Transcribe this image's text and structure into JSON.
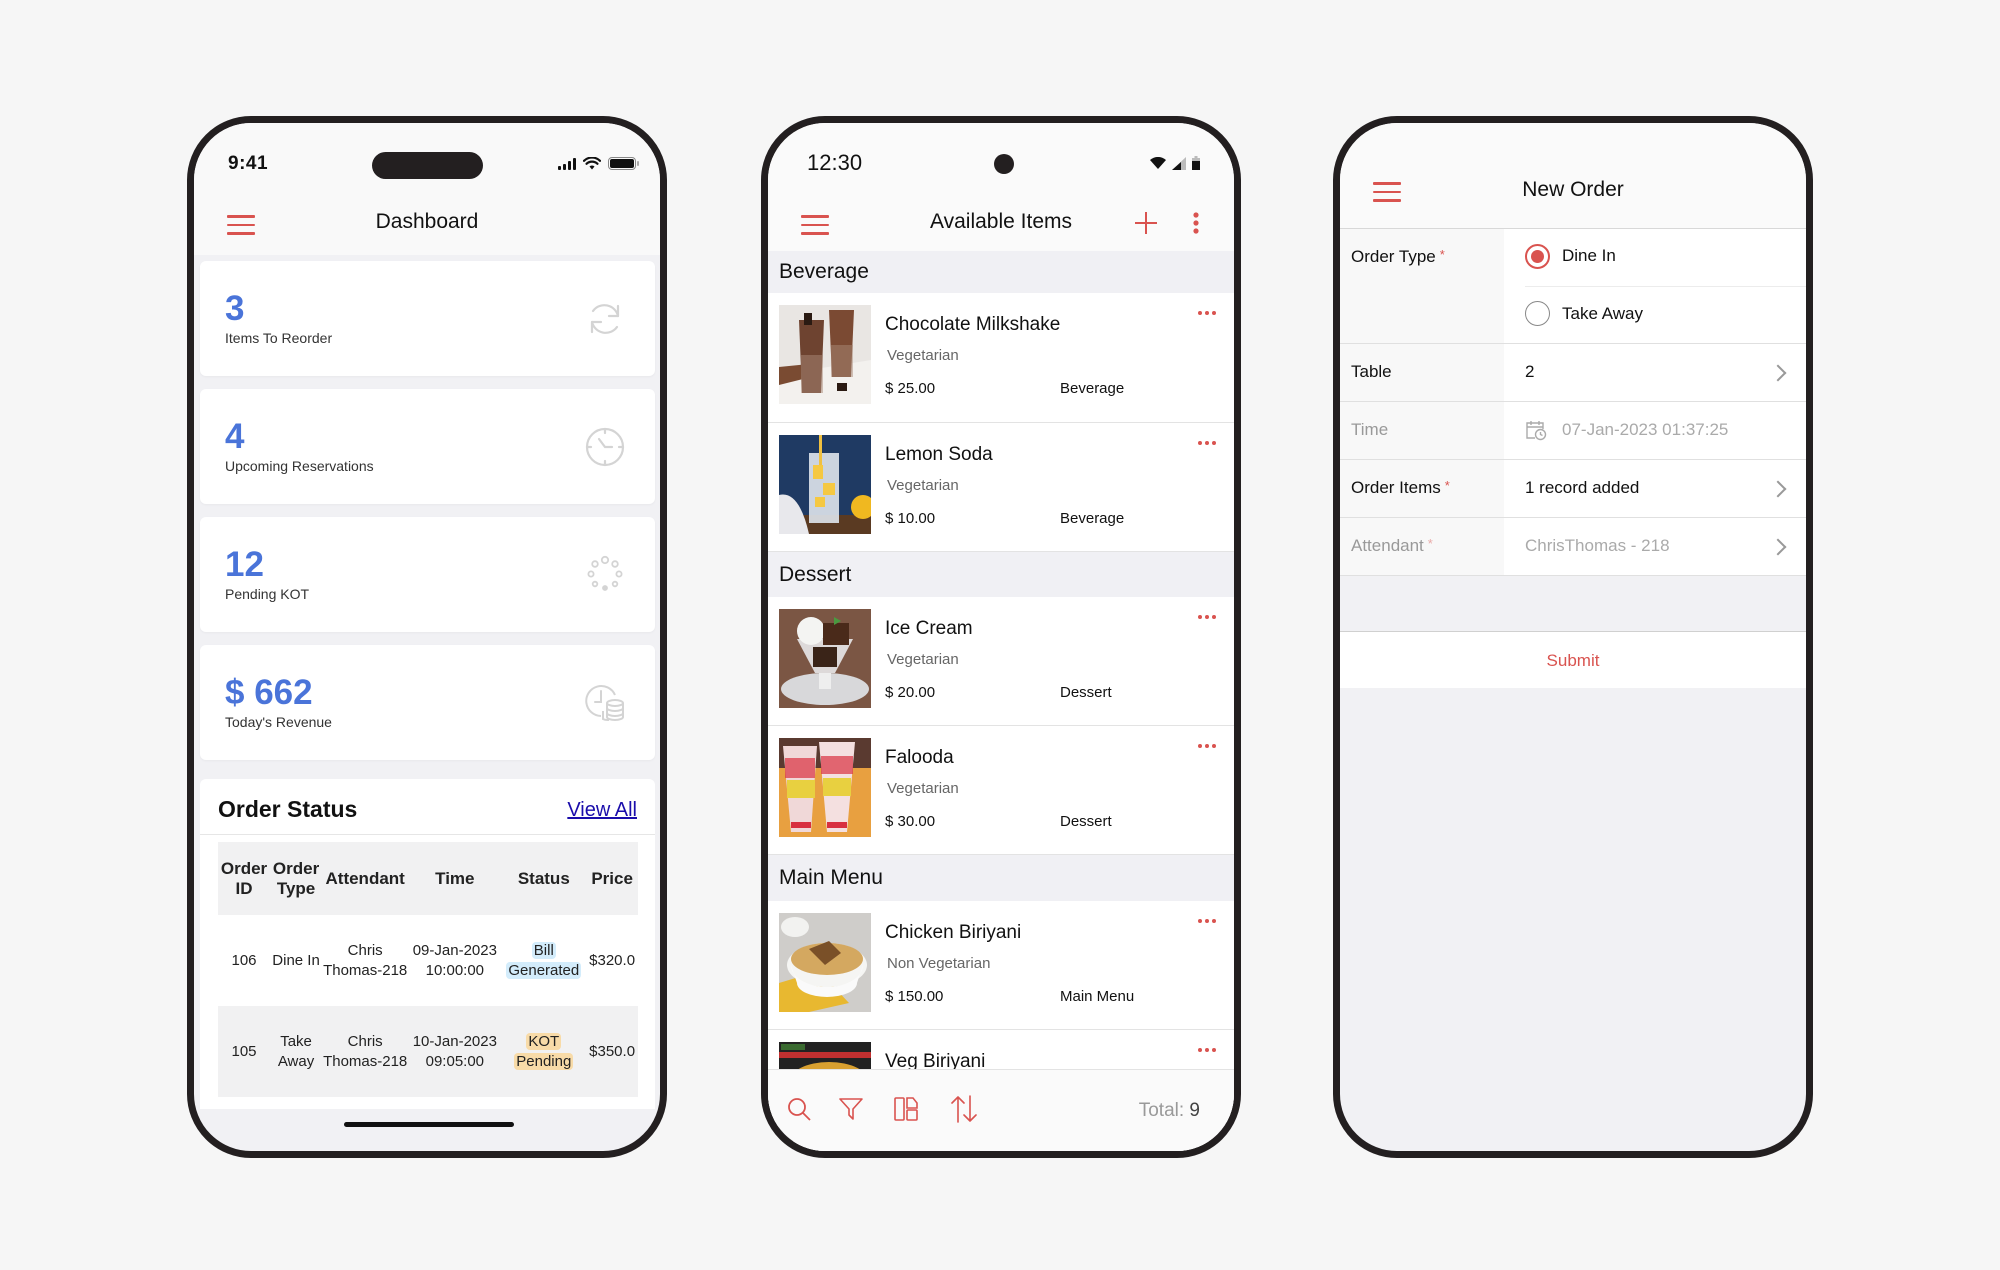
{
  "colors": {
    "accent": "#d9534f",
    "stat_blue": "#4a74d9",
    "link_blue": "#1a0dab",
    "badge_blue": "#d3ecfb",
    "badge_orange": "#f8dba8"
  },
  "dashboard": {
    "status_time": "9:41",
    "title": "Dashboard",
    "stats": [
      {
        "value": "3",
        "label": "Items To Reorder",
        "icon": "refresh-icon"
      },
      {
        "value": "4",
        "label": "Upcoming Reservations",
        "icon": "clock-icon"
      },
      {
        "value": "12",
        "label": "Pending KOT",
        "icon": "loading-dots-icon"
      },
      {
        "value": "$ 662",
        "label": "Today's Revenue",
        "icon": "revenue-coins-icon"
      }
    ],
    "order_status": {
      "title": "Order Status",
      "view_all": "View All",
      "columns": [
        "Order ID",
        "Order Type",
        "Attendant",
        "Time",
        "Status",
        "Price"
      ],
      "rows": [
        {
          "order_id": "106",
          "order_type": "Dine In",
          "attendant": "Chris Thomas-218",
          "time_date": "09-Jan-2023",
          "time_clock": "10:00:00",
          "status": "Bill Generated",
          "price": "$320.0"
        },
        {
          "order_id": "105",
          "order_type": "Take Away",
          "attendant": "Chris Thomas-218",
          "time_date": "10-Jan-2023",
          "time_clock": "09:05:00",
          "status": "KOT Pending",
          "price": "$350.0"
        }
      ]
    }
  },
  "items_screen": {
    "status_time": "12:30",
    "title": "Available Items",
    "sections": [
      {
        "name": "Beverage",
        "items": [
          {
            "name": "Chocolate Milkshake",
            "type": "Vegetarian",
            "price": "$ 25.00",
            "category": "Beverage"
          },
          {
            "name": "Lemon Soda",
            "type": "Vegetarian",
            "price": "$ 10.00",
            "category": "Beverage"
          }
        ]
      },
      {
        "name": "Dessert",
        "items": [
          {
            "name": "Ice Cream",
            "type": "Vegetarian",
            "price": "$ 20.00",
            "category": "Dessert"
          },
          {
            "name": "Falooda",
            "type": "Vegetarian",
            "price": "$ 30.00",
            "category": "Dessert"
          }
        ]
      },
      {
        "name": "Main Menu",
        "items": [
          {
            "name": "Chicken Biriyani",
            "type": "Non Vegetarian",
            "price": "$ 150.00",
            "category": "Main Menu"
          },
          {
            "name": "Veg Biriyani",
            "type": "",
            "price": "",
            "category": ""
          }
        ]
      }
    ],
    "bottom_bar": {
      "total_label": "Total:",
      "total_value": "9"
    }
  },
  "new_order": {
    "title": "New Order",
    "fields": {
      "order_type": {
        "label": "Order Type",
        "required_mark": "*",
        "options": [
          "Dine In",
          "Take Away"
        ],
        "selected": "Dine In"
      },
      "table": {
        "label": "Table",
        "value": "2"
      },
      "time": {
        "label": "Time",
        "value": "07-Jan-2023 01:37:25"
      },
      "order_items": {
        "label": "Order Items",
        "required_mark": "*",
        "value": "1 record added"
      },
      "attendant": {
        "label": "Attendant",
        "required_mark": "*",
        "value": "ChrisThomas - 218"
      }
    },
    "submit_label": "Submit"
  }
}
